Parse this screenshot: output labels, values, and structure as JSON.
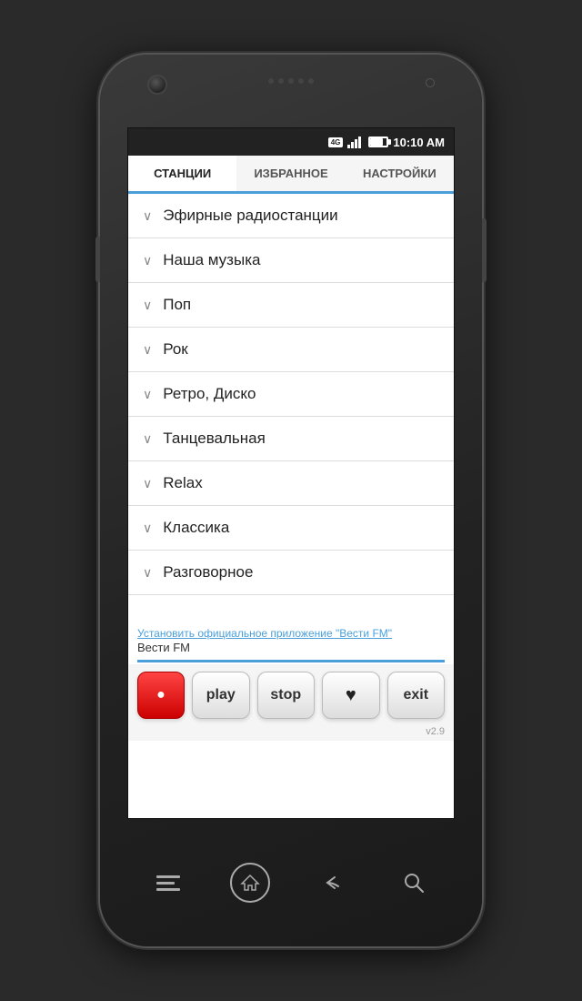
{
  "statusBar": {
    "time": "10:10 AM",
    "network": "4G"
  },
  "tabs": [
    {
      "id": "stations",
      "label": "СТАНЦИИ",
      "active": true
    },
    {
      "id": "favorites",
      "label": "ИЗБРАННОЕ",
      "active": false
    },
    {
      "id": "settings",
      "label": "НАСТРОЙКИ",
      "active": false
    }
  ],
  "stationCategories": [
    {
      "id": 1,
      "name": "Эфирные радиостанции"
    },
    {
      "id": 2,
      "name": "Наша музыка"
    },
    {
      "id": 3,
      "name": "Поп"
    },
    {
      "id": 4,
      "name": "Рок"
    },
    {
      "id": 5,
      "name": "Ретро, Диско"
    },
    {
      "id": 6,
      "name": "Танцевальная"
    },
    {
      "id": 7,
      "name": "Relax"
    },
    {
      "id": 8,
      "name": "Классика"
    },
    {
      "id": 9,
      "name": "Разговорное"
    }
  ],
  "infoBar": {
    "installLink": "Установить официальное приложение \"Вести FM\"",
    "currentStation": "Вести FM"
  },
  "controls": {
    "recordLabel": "●",
    "playLabel": "play",
    "stopLabel": "stop",
    "favoriteLabel": "♥",
    "exitLabel": "exit"
  },
  "version": "v2.9",
  "navIcons": {
    "menu": "☰",
    "home": "⌂",
    "back": "↩",
    "search": "🔍"
  }
}
